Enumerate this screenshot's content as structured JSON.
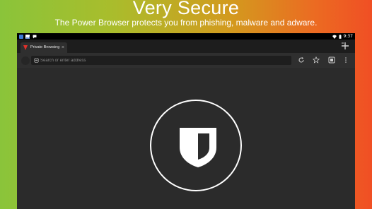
{
  "promo": {
    "title": "Very Secure",
    "subtitle": "The Power Browser protects you from phishing, malware and adware."
  },
  "status_bar": {
    "time": "9:37",
    "left_icons": [
      "notification-app-icon",
      "image-notification-icon",
      "chat-notification-icon"
    ],
    "right_icons": [
      "wifi-icon",
      "battery-icon"
    ]
  },
  "tab": {
    "title": "Private Browsing",
    "close": "×"
  },
  "omnibox": {
    "placeholder": "Search or enter address",
    "value": ""
  },
  "toolbar": {
    "icons": [
      "reload-icon",
      "bookmark-star-icon",
      "tab-switcher-icon",
      "overflow-menu-icon"
    ]
  },
  "content": {
    "icon": "shield-icon"
  },
  "colors": {
    "gradient_left": "#8ac43a",
    "gradient_right": "#f04f24",
    "browser_bg": "#2b2b2b",
    "tab_strip": "#1d1d1d",
    "favicon_red": "#e0302a"
  }
}
